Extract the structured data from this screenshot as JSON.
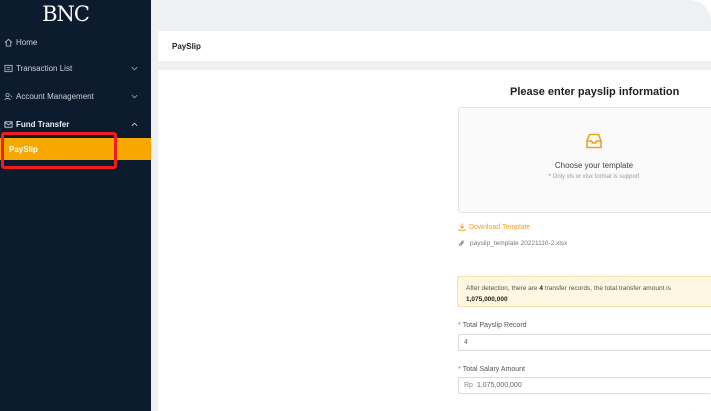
{
  "logo": {
    "text": "BNC"
  },
  "sidebar": {
    "items": [
      {
        "label": "Home",
        "icon": "home-icon"
      },
      {
        "label": "Transaction List",
        "icon": "list-icon"
      },
      {
        "label": "Account Management",
        "icon": "account-icon"
      },
      {
        "label": "Fund Transfer",
        "icon": "mail-icon"
      }
    ],
    "submenu_active": "PaySlip"
  },
  "topbar": {
    "title": "PaySlip"
  },
  "form": {
    "title": "Please enter payslip information",
    "upload": {
      "choose_text": "Choose your template",
      "hint": "Only xls or xlsx format is support"
    },
    "download_label": "Download Template",
    "file_name": "payslip_template 20221110-2.xlsx",
    "notice": {
      "prefix": "After detection, there are ",
      "count": "4",
      "middle": " transfer records, the total transfer amount is ",
      "amount": "1,075,000,000"
    },
    "fields": [
      {
        "label": "Total Payslip Record",
        "value": "4",
        "prefix": ""
      },
      {
        "label": "Total Salary Amount",
        "value": "1,075,000,000",
        "prefix": "Rp"
      }
    ]
  },
  "colors": {
    "sidebar_bg": "#0d1b2e",
    "accent": "#f6a800",
    "highlight_border": "#ef1d1d"
  }
}
